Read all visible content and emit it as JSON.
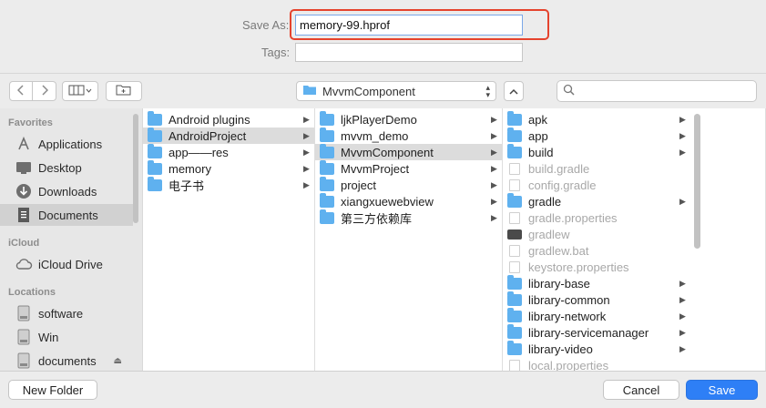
{
  "form": {
    "save_as_label": "Save As:",
    "filename": "memory-99.hprof",
    "tags_label": "Tags:",
    "tags_value": ""
  },
  "toolbar": {
    "current_folder": "MvvmComponent",
    "search_placeholder": ""
  },
  "sidebar": {
    "sections": [
      {
        "title": "Favorites",
        "items": [
          {
            "label": "Applications",
            "icon": "applications-icon",
            "selected": false
          },
          {
            "label": "Desktop",
            "icon": "desktop-icon",
            "selected": false
          },
          {
            "label": "Downloads",
            "icon": "downloads-icon",
            "selected": false
          },
          {
            "label": "Documents",
            "icon": "documents-icon",
            "selected": true
          }
        ]
      },
      {
        "title": "iCloud",
        "items": [
          {
            "label": "iCloud Drive",
            "icon": "cloud-icon",
            "selected": false
          }
        ]
      },
      {
        "title": "Locations",
        "items": [
          {
            "label": "software",
            "icon": "disk-icon",
            "selected": false
          },
          {
            "label": "Win",
            "icon": "disk-icon",
            "selected": false
          },
          {
            "label": "documents",
            "icon": "disk-icon",
            "selected": false
          }
        ]
      }
    ]
  },
  "columns": [
    [
      {
        "name": "Android plugins",
        "kind": "folder",
        "arrow": true
      },
      {
        "name": "AndroidProject",
        "kind": "folder",
        "arrow": true,
        "selected": true
      },
      {
        "name": "app——res",
        "kind": "folder",
        "arrow": true
      },
      {
        "name": "memory",
        "kind": "folder",
        "arrow": true
      },
      {
        "name": "电子书",
        "kind": "folder",
        "arrow": true
      }
    ],
    [
      {
        "name": "ljkPlayerDemo",
        "kind": "folder",
        "arrow": true
      },
      {
        "name": "mvvm_demo",
        "kind": "folder",
        "arrow": true
      },
      {
        "name": "MvvmComponent",
        "kind": "folder",
        "arrow": true,
        "selected": true
      },
      {
        "name": "MvvmProject",
        "kind": "folder",
        "arrow": true
      },
      {
        "name": "project",
        "kind": "folder",
        "arrow": true
      },
      {
        "name": "xiangxuewebview",
        "kind": "folder",
        "arrow": true
      },
      {
        "name": "第三方依赖库",
        "kind": "folder",
        "arrow": true
      }
    ],
    [
      {
        "name": "apk",
        "kind": "folder",
        "arrow": true
      },
      {
        "name": "app",
        "kind": "folder",
        "arrow": true
      },
      {
        "name": "build",
        "kind": "folder",
        "arrow": true
      },
      {
        "name": "build.gradle",
        "kind": "file",
        "dim": true
      },
      {
        "name": "config.gradle",
        "kind": "file",
        "dim": true
      },
      {
        "name": "gradle",
        "kind": "folder",
        "arrow": true
      },
      {
        "name": "gradle.properties",
        "kind": "file",
        "dim": true
      },
      {
        "name": "gradlew",
        "kind": "exec",
        "dim": true
      },
      {
        "name": "gradlew.bat",
        "kind": "file",
        "dim": true
      },
      {
        "name": "keystore.properties",
        "kind": "file",
        "dim": true
      },
      {
        "name": "library-base",
        "kind": "folder",
        "arrow": true
      },
      {
        "name": "library-common",
        "kind": "folder",
        "arrow": true
      },
      {
        "name": "library-network",
        "kind": "folder",
        "arrow": true
      },
      {
        "name": "library-servicemanager",
        "kind": "folder",
        "arrow": true
      },
      {
        "name": "library-video",
        "kind": "folder",
        "arrow": true
      },
      {
        "name": "local.properties",
        "kind": "file",
        "dim": true
      }
    ]
  ],
  "buttons": {
    "new_folder": "New Folder",
    "cancel": "Cancel",
    "save": "Save"
  },
  "colors": {
    "accent": "#2e7ff6",
    "highlight_box": "#e5432d",
    "folder": "#5fb1ef"
  }
}
